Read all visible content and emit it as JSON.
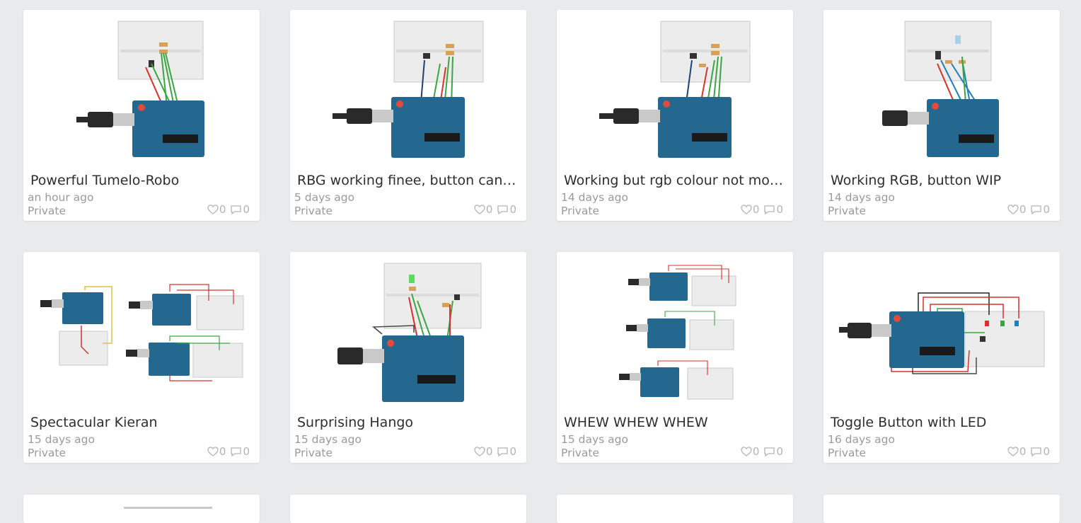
{
  "designs": [
    {
      "title": "Powerful Tumelo-Robo",
      "time": "an hour ago",
      "visibility": "Private",
      "likes": "0",
      "comments": "0",
      "thumb": "led-board"
    },
    {
      "title": "RBG working finee, button can ...",
      "time": "5 days ago",
      "visibility": "Private",
      "likes": "0",
      "comments": "0",
      "thumb": "led-board"
    },
    {
      "title": "Working but rgb colour not mov...",
      "time": "14 days ago",
      "visibility": "Private",
      "likes": "0",
      "comments": "0",
      "thumb": "led-board"
    },
    {
      "title": "Working RGB, button WIP",
      "time": "14 days ago",
      "visibility": "Private",
      "likes": "0",
      "comments": "0",
      "thumb": "rgb-board"
    },
    {
      "title": "Spectacular Kieran",
      "time": "15 days ago",
      "visibility": "Private",
      "likes": "0",
      "comments": "0",
      "thumb": "three-arduinos"
    },
    {
      "title": "Surprising Hango",
      "time": "15 days ago",
      "visibility": "Private",
      "likes": "0",
      "comments": "0",
      "thumb": "button-led"
    },
    {
      "title": "WHEW WHEW WHEW",
      "time": "15 days ago",
      "visibility": "Private",
      "likes": "0",
      "comments": "0",
      "thumb": "three-stack"
    },
    {
      "title": "Toggle Button with LED",
      "time": "16 days ago",
      "visibility": "Private",
      "likes": "0",
      "comments": "0",
      "thumb": "side-board"
    }
  ],
  "icons": {
    "like": "heart-icon",
    "comment": "speech-bubble-icon"
  },
  "colors": {
    "arduino_blue": "#24678f",
    "breadboard": "#ececec",
    "wire_red": "#d9312b",
    "wire_green": "#3aa641",
    "text_muted": "#9a9a9a"
  }
}
